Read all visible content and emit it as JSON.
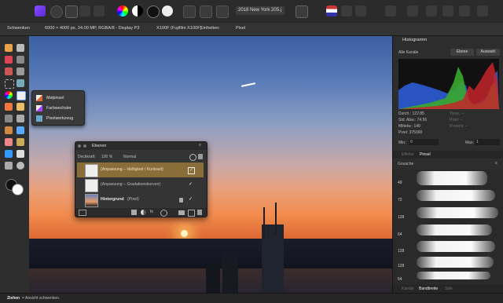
{
  "toolbar": {
    "document_tab": "2018 New York 205.j"
  },
  "context_bar": {
    "tool_name": "Schwenken",
    "image_info": "6000 × 4000 px, 24.00 MP, RGBA/8 - Display P3",
    "camera": "X100F (Fujifilm X100F)",
    "units_label": "Einheiten:",
    "units_value": "Pixel"
  },
  "tool_popover": {
    "items": [
      {
        "label": "Malpinsel",
        "icon": "paint-brush-icon"
      },
      {
        "label": "Farbwechsler",
        "icon": "color-replacement-icon"
      },
      {
        "label": "Pixelwerkzeug",
        "icon": "pixel-tool-icon"
      }
    ]
  },
  "layers": {
    "title": "Ebenen",
    "opacity_label": "Deckkraft:",
    "opacity_value": "100 %",
    "blend_mode": "Normal",
    "rows": [
      {
        "name": "(Anpassung – Helligkeit / Kontrast)",
        "visible": true,
        "selected": true
      },
      {
        "name": "(Anpassung – Gradationskurven)",
        "visible": true,
        "selected": false
      },
      {
        "name": "Hintergrund",
        "suffix": "(Pixel)",
        "visible": true,
        "locked": true,
        "selected": false
      }
    ]
  },
  "histogram": {
    "title": "Histogramm",
    "channel_select": "Alle Kanäle",
    "tab_layer": "Ebene",
    "tab_selection": "Auswahl",
    "stats_left": [
      {
        "label": "Durch.:",
        "value": "122.85"
      },
      {
        "label": "Std. Abw.:",
        "value": "74.56"
      },
      {
        "label": "Mittelw.:",
        "value": "149"
      },
      {
        "label": "Pixel:",
        "value": "375000"
      }
    ],
    "stats_right": [
      {
        "label": "Tonw.:",
        "value": "–"
      },
      {
        "label": "Pixel:",
        "value": "–"
      },
      {
        "label": "Prozent:",
        "value": "–"
      }
    ],
    "min_label": "Min:",
    "min_value": "0",
    "max_label": "Max:",
    "max_value": "1"
  },
  "brushes": {
    "tabs": [
      "Effekte",
      "Pinsel"
    ],
    "category": "Gouache",
    "sizes": [
      "49",
      "72",
      "128",
      "64",
      "128",
      "128",
      "64"
    ],
    "bottom_tabs": [
      "Kanäle",
      "Bandbreite",
      "Stile"
    ]
  },
  "status": {
    "key": "Ziehen",
    "text": "= Ansicht schwenken."
  }
}
